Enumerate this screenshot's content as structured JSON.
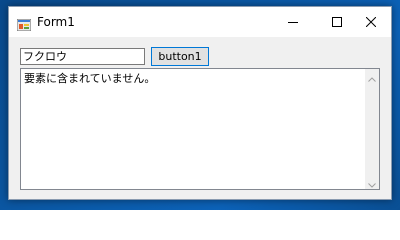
{
  "window": {
    "title": "Form1"
  },
  "form": {
    "input_value": "フクロウ",
    "button_label": "button1",
    "output_text": "要素に含まれていません。"
  },
  "icons": {
    "app": "form-app-icon",
    "minimize": "minimize-icon",
    "maximize": "maximize-icon",
    "close": "close-icon",
    "scroll_up": "chevron-up-icon",
    "scroll_down": "chevron-down-icon"
  },
  "colors": {
    "button_focus_border": "#0078d7",
    "window_background": "#f0f0f0"
  }
}
